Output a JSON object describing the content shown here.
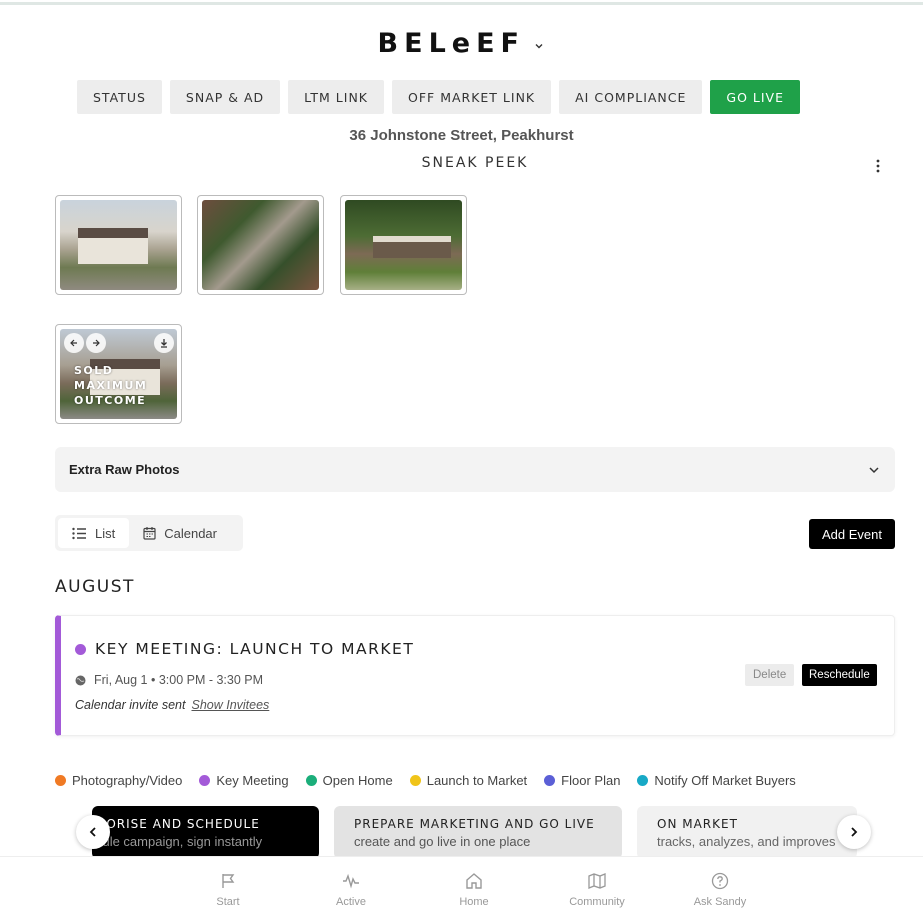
{
  "brand": {
    "title": "BELeEF"
  },
  "tabs": [
    {
      "label": "STATUS"
    },
    {
      "label": "SNAP & AD"
    },
    {
      "label": "LTM LINK"
    },
    {
      "label": "OFF MARKET LINK"
    },
    {
      "label": "AI COMPLIANCE"
    },
    {
      "label": "GO LIVE"
    }
  ],
  "colors": {
    "go_live": "#1fa149",
    "key_meeting": "#a35ad8"
  },
  "address": "36 Johnstone Street, Peakhurst",
  "gallery": {
    "title": "SNEAK PEEK",
    "overlay_text": [
      "SOLD",
      "MAXIMUM",
      "OUTCOME"
    ]
  },
  "accordion": {
    "label": "Extra Raw Photos"
  },
  "view_toggle": {
    "list": "List",
    "calendar": "Calendar"
  },
  "add_event": "Add Event",
  "month": "AUGUST",
  "event": {
    "title": "KEY MEETING: LAUNCH TO MARKET",
    "time": "Fri, Aug 1 • 3:00 PM - 3:30 PM",
    "invite_status": "Calendar invite sent",
    "show_invitees": "Show Invitees",
    "delete": "Delete",
    "reschedule": "Reschedule"
  },
  "legend": [
    {
      "label": "Photography/Video",
      "color": "#f07a24"
    },
    {
      "label": "Key Meeting",
      "color": "#a35ad8"
    },
    {
      "label": "Open Home",
      "color": "#1bae7a"
    },
    {
      "label": "Launch to Market",
      "color": "#f0c419"
    },
    {
      "label": "Floor Plan",
      "color": "#5b5fd6"
    },
    {
      "label": "Notify Off Market Buyers",
      "color": "#17a9c6"
    }
  ],
  "stages": [
    {
      "title": "THORISE AND SCHEDULE",
      "subtitle": "edule campaign, sign instantly"
    },
    {
      "title": "PREPARE MARKETING AND GO LIVE",
      "subtitle": "create and go live in one place"
    },
    {
      "title": "ON MARKET",
      "subtitle": "tracks, analyzes, and improves"
    }
  ],
  "nav": [
    {
      "label": "Start",
      "icon": "flag-icon"
    },
    {
      "label": "Active",
      "icon": "activity-icon"
    },
    {
      "label": "Home",
      "icon": "home-icon"
    },
    {
      "label": "Community",
      "icon": "map-icon"
    },
    {
      "label": "Ask Sandy",
      "icon": "help-icon"
    }
  ]
}
